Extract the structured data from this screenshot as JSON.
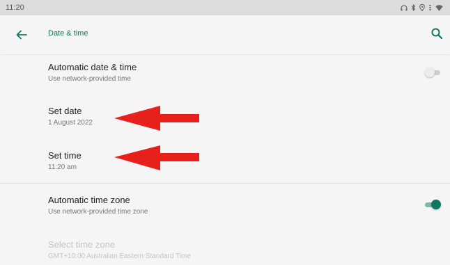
{
  "status_bar": {
    "time": "11:20",
    "icons": [
      "headphones-icon",
      "bluetooth-icon",
      "location-icon",
      "signal-icon",
      "wifi-icon"
    ]
  },
  "app_bar": {
    "title": "Date & time",
    "back_icon": "arrow-back-icon",
    "search_icon": "search-icon"
  },
  "settings": {
    "auto_date": {
      "title": "Automatic date & time",
      "summary": "Use network-provided time",
      "enabled": false
    },
    "set_date": {
      "title": "Set date",
      "summary": "1 August 2022"
    },
    "set_time": {
      "title": "Set time",
      "summary": "11:20 am"
    },
    "auto_zone": {
      "title": "Automatic time zone",
      "summary": "Use network-provided time zone",
      "enabled": true
    },
    "select_zone": {
      "title": "Select time zone",
      "summary": "GMT+10:00 Australian Eastern Standard Time",
      "disabled": true
    }
  },
  "annotations": {
    "arrow_color": "#e8201c"
  },
  "colors": {
    "accent": "#137564",
    "title_accent": "#0f6f60"
  }
}
